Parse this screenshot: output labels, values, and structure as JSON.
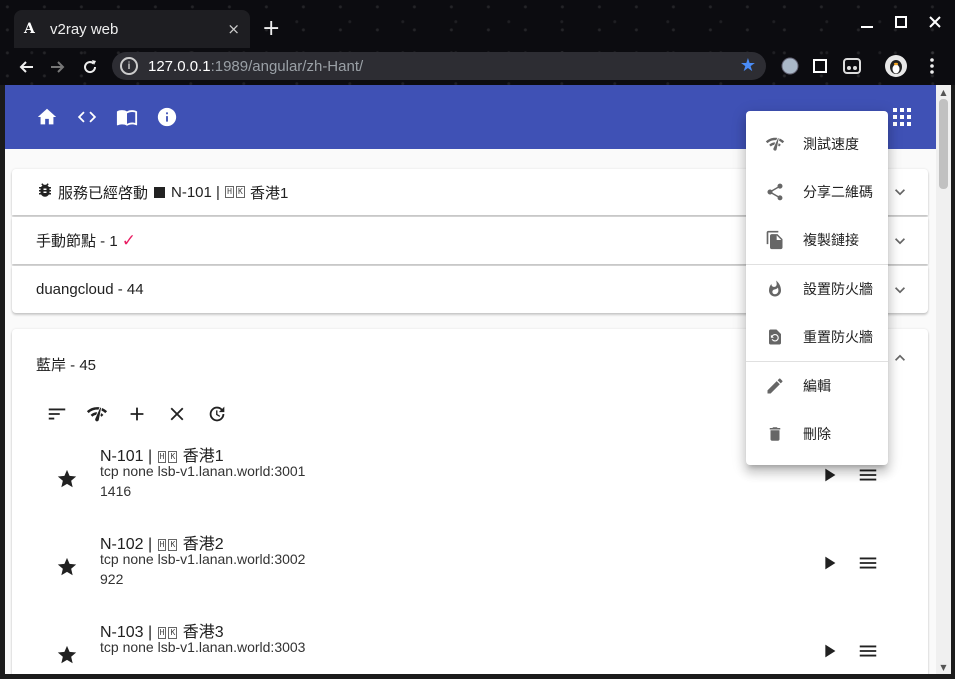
{
  "browser": {
    "tab_favicon": "A",
    "tab_title": "v2ray web",
    "tab_close": "×",
    "new_tab": "+",
    "url_host": "127.0.0.1",
    "url_path": ":1989/angular/zh-Hant/"
  },
  "appbar": {
    "icons": [
      "home-icon",
      "code-icon",
      "book-icon",
      "info-icon"
    ],
    "right_icon": "apps-grid-icon",
    "color": "#3f51b5"
  },
  "panels": {
    "status": {
      "text": "服務已經啓動",
      "node_name": "N-101 |",
      "flag_h": "H",
      "flag_k": "K",
      "city": "香港1"
    },
    "manual": {
      "label": "手動節點 - 1",
      "check": "✓"
    },
    "duang": {
      "label": "duangcloud - 44"
    },
    "lan": {
      "label": "藍岸 - 45"
    }
  },
  "nodes": [
    {
      "name": "N-101 |",
      "city": "香港1",
      "detail": "tcp none lsb-v1.lanan.world:3001",
      "ping": "1416"
    },
    {
      "name": "N-102 |",
      "city": "香港2",
      "detail": "tcp none lsb-v1.lanan.world:3002",
      "ping": "922"
    },
    {
      "name": "N-103 |",
      "city": "香港3",
      "detail": "tcp none lsb-v1.lanan.world:3003",
      "ping": ""
    }
  ],
  "context_menu": [
    {
      "label": "測試速度",
      "icon": "network-check-icon"
    },
    {
      "label": "分享二維碼",
      "icon": "share-icon"
    },
    {
      "label": "複製鏈接",
      "icon": "copy-icon"
    },
    {
      "label": "設置防火牆",
      "icon": "fire-icon"
    },
    {
      "label": "重置防火牆",
      "icon": "restore-page-icon"
    },
    {
      "label": "編輯",
      "icon": "edit-icon"
    },
    {
      "label": "刪除",
      "icon": "delete-icon"
    }
  ],
  "colors": {
    "accent": "#e91e63",
    "primary": "#3f51b5",
    "star": "#4a8cf7"
  }
}
